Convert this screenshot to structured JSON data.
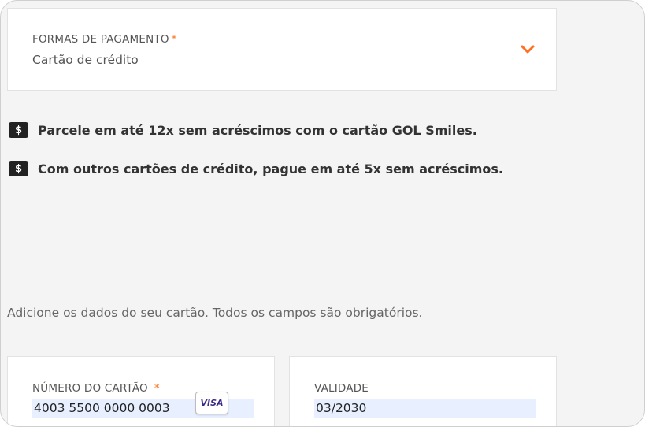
{
  "payment": {
    "label": "FORMAS DE PAGAMENTO",
    "required_mark": "*",
    "value": "Cartão de crédito",
    "chevron_icon": "chevron-down-icon",
    "accent_color": "#ff7020"
  },
  "info": [
    {
      "icon": "dollar-icon",
      "symbol": "$",
      "text": "Parcele em até 12x sem acréscimos com o cartão GOL Smiles."
    },
    {
      "icon": "dollar-icon",
      "symbol": "$",
      "text": "Com outros cartões de crédito, pague em até 5x sem acréscimos."
    }
  ],
  "instructions": "Adicione os dados do seu cartão. Todos os campos são obrigatórios.",
  "card_number": {
    "label": "NÚMERO DO CARTÃO",
    "required_mark": "*",
    "value": "4003 5500 0000 0003",
    "brand": "VISA"
  },
  "expiry": {
    "label": "VALIDADE",
    "value": "03/2030"
  }
}
